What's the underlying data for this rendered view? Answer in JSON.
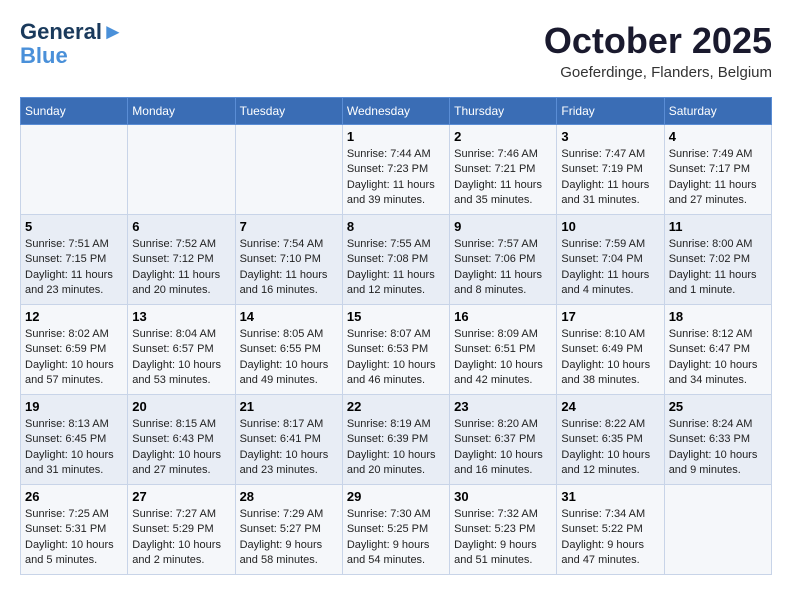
{
  "header": {
    "logo_line1": "General",
    "logo_line2": "Blue",
    "month": "October 2025",
    "location": "Goeferdinge, Flanders, Belgium"
  },
  "days_of_week": [
    "Sunday",
    "Monday",
    "Tuesday",
    "Wednesday",
    "Thursday",
    "Friday",
    "Saturday"
  ],
  "weeks": [
    [
      {
        "day": "",
        "content": ""
      },
      {
        "day": "",
        "content": ""
      },
      {
        "day": "",
        "content": ""
      },
      {
        "day": "1",
        "content": "Sunrise: 7:44 AM\nSunset: 7:23 PM\nDaylight: 11 hours\nand 39 minutes."
      },
      {
        "day": "2",
        "content": "Sunrise: 7:46 AM\nSunset: 7:21 PM\nDaylight: 11 hours\nand 35 minutes."
      },
      {
        "day": "3",
        "content": "Sunrise: 7:47 AM\nSunset: 7:19 PM\nDaylight: 11 hours\nand 31 minutes."
      },
      {
        "day": "4",
        "content": "Sunrise: 7:49 AM\nSunset: 7:17 PM\nDaylight: 11 hours\nand 27 minutes."
      }
    ],
    [
      {
        "day": "5",
        "content": "Sunrise: 7:51 AM\nSunset: 7:15 PM\nDaylight: 11 hours\nand 23 minutes."
      },
      {
        "day": "6",
        "content": "Sunrise: 7:52 AM\nSunset: 7:12 PM\nDaylight: 11 hours\nand 20 minutes."
      },
      {
        "day": "7",
        "content": "Sunrise: 7:54 AM\nSunset: 7:10 PM\nDaylight: 11 hours\nand 16 minutes."
      },
      {
        "day": "8",
        "content": "Sunrise: 7:55 AM\nSunset: 7:08 PM\nDaylight: 11 hours\nand 12 minutes."
      },
      {
        "day": "9",
        "content": "Sunrise: 7:57 AM\nSunset: 7:06 PM\nDaylight: 11 hours\nand 8 minutes."
      },
      {
        "day": "10",
        "content": "Sunrise: 7:59 AM\nSunset: 7:04 PM\nDaylight: 11 hours\nand 4 minutes."
      },
      {
        "day": "11",
        "content": "Sunrise: 8:00 AM\nSunset: 7:02 PM\nDaylight: 11 hours\nand 1 minute."
      }
    ],
    [
      {
        "day": "12",
        "content": "Sunrise: 8:02 AM\nSunset: 6:59 PM\nDaylight: 10 hours\nand 57 minutes."
      },
      {
        "day": "13",
        "content": "Sunrise: 8:04 AM\nSunset: 6:57 PM\nDaylight: 10 hours\nand 53 minutes."
      },
      {
        "day": "14",
        "content": "Sunrise: 8:05 AM\nSunset: 6:55 PM\nDaylight: 10 hours\nand 49 minutes."
      },
      {
        "day": "15",
        "content": "Sunrise: 8:07 AM\nSunset: 6:53 PM\nDaylight: 10 hours\nand 46 minutes."
      },
      {
        "day": "16",
        "content": "Sunrise: 8:09 AM\nSunset: 6:51 PM\nDaylight: 10 hours\nand 42 minutes."
      },
      {
        "day": "17",
        "content": "Sunrise: 8:10 AM\nSunset: 6:49 PM\nDaylight: 10 hours\nand 38 minutes."
      },
      {
        "day": "18",
        "content": "Sunrise: 8:12 AM\nSunset: 6:47 PM\nDaylight: 10 hours\nand 34 minutes."
      }
    ],
    [
      {
        "day": "19",
        "content": "Sunrise: 8:13 AM\nSunset: 6:45 PM\nDaylight: 10 hours\nand 31 minutes."
      },
      {
        "day": "20",
        "content": "Sunrise: 8:15 AM\nSunset: 6:43 PM\nDaylight: 10 hours\nand 27 minutes."
      },
      {
        "day": "21",
        "content": "Sunrise: 8:17 AM\nSunset: 6:41 PM\nDaylight: 10 hours\nand 23 minutes."
      },
      {
        "day": "22",
        "content": "Sunrise: 8:19 AM\nSunset: 6:39 PM\nDaylight: 10 hours\nand 20 minutes."
      },
      {
        "day": "23",
        "content": "Sunrise: 8:20 AM\nSunset: 6:37 PM\nDaylight: 10 hours\nand 16 minutes."
      },
      {
        "day": "24",
        "content": "Sunrise: 8:22 AM\nSunset: 6:35 PM\nDaylight: 10 hours\nand 12 minutes."
      },
      {
        "day": "25",
        "content": "Sunrise: 8:24 AM\nSunset: 6:33 PM\nDaylight: 10 hours\nand 9 minutes."
      }
    ],
    [
      {
        "day": "26",
        "content": "Sunrise: 7:25 AM\nSunset: 5:31 PM\nDaylight: 10 hours\nand 5 minutes."
      },
      {
        "day": "27",
        "content": "Sunrise: 7:27 AM\nSunset: 5:29 PM\nDaylight: 10 hours\nand 2 minutes."
      },
      {
        "day": "28",
        "content": "Sunrise: 7:29 AM\nSunset: 5:27 PM\nDaylight: 9 hours\nand 58 minutes."
      },
      {
        "day": "29",
        "content": "Sunrise: 7:30 AM\nSunset: 5:25 PM\nDaylight: 9 hours\nand 54 minutes."
      },
      {
        "day": "30",
        "content": "Sunrise: 7:32 AM\nSunset: 5:23 PM\nDaylight: 9 hours\nand 51 minutes."
      },
      {
        "day": "31",
        "content": "Sunrise: 7:34 AM\nSunset: 5:22 PM\nDaylight: 9 hours\nand 47 minutes."
      },
      {
        "day": "",
        "content": ""
      }
    ]
  ]
}
